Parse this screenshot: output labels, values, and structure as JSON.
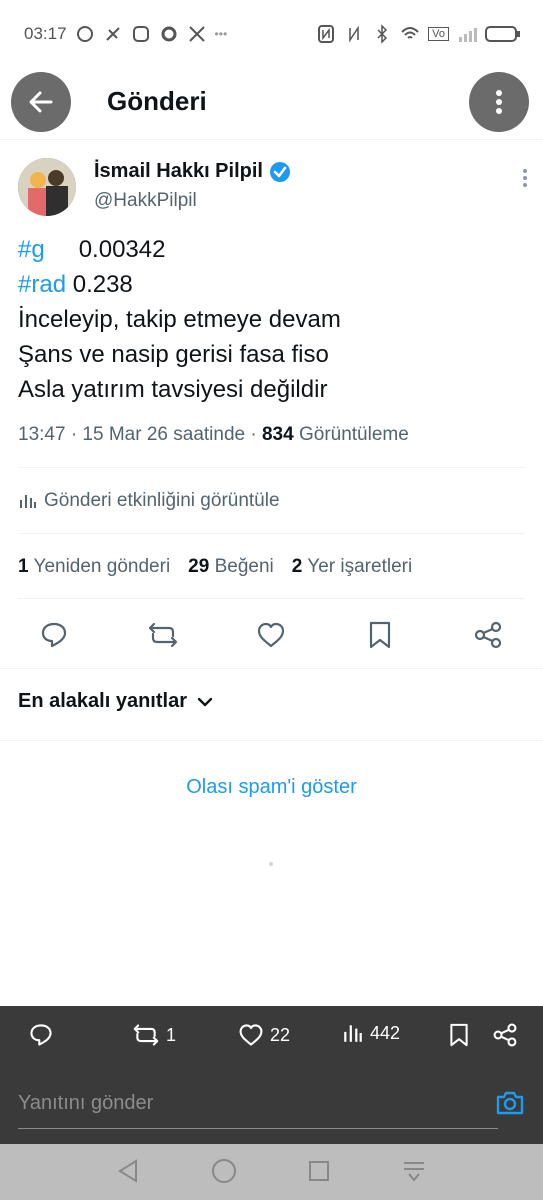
{
  "status_bar": {
    "time": "03:17",
    "right_label": "Vo"
  },
  "header": {
    "title": "Gönderi"
  },
  "author": {
    "name": "İsmail Hakkı Pilpil",
    "handle": "@HakkPilpil"
  },
  "post": {
    "line1_tag": "#g",
    "line1_value": "0.00342",
    "line2_tag": "#rad",
    "line2_value": "0.238",
    "line3": "İnceleyip, takip etmeye devam",
    "line4": "Şans ve nasip gerisi fasa fiso",
    "line5": "Asla yatırım tavsiyesi değildir"
  },
  "meta": {
    "time": "13:47",
    "date": "· 15 Mar 26 saatinde ·",
    "views_count": "834",
    "views_label": "Görüntüleme"
  },
  "activity_label": "Gönderi etkinliğini görüntüle",
  "stats": {
    "reposts_count": "1",
    "reposts_label": "Yeniden gönderi",
    "likes_count": "29",
    "likes_label": "Beğeni",
    "bookmarks_count": "2",
    "bookmarks_label": "Yer işaretleri"
  },
  "sort_label": "En alakalı yanıtlar",
  "spam_link": "Olası spam'i göster",
  "bottom_bar": {
    "reposts": "1",
    "likes": "22",
    "views": "442"
  },
  "reply": {
    "placeholder": "Yanıtını gönder"
  },
  "colors": {
    "accent": "#1d9bf0",
    "text": "#0f1419",
    "muted": "#536471",
    "dark_bar": "#3a3a3a"
  }
}
